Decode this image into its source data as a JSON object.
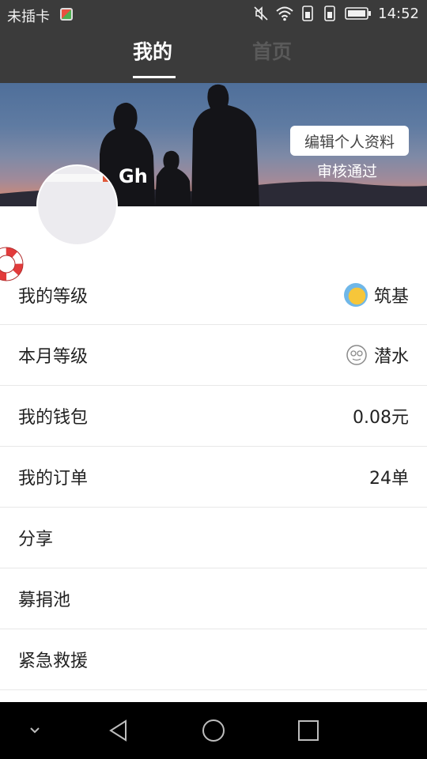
{
  "status_bar": {
    "carrier": "未插卡",
    "time": "14:52"
  },
  "tabs": [
    {
      "label": "我的",
      "active": true
    },
    {
      "label": "首页",
      "active": false
    }
  ],
  "profile": {
    "edit_button": "编辑个人资料",
    "review_status": "审核通过",
    "username": "Gh"
  },
  "menu": [
    {
      "label": "我的等级",
      "value": "筑基",
      "icon": "level-badge-icon"
    },
    {
      "label": "本月等级",
      "value": "潜水",
      "icon": "diver-badge-icon"
    },
    {
      "label": "我的钱包",
      "value": "0.08元"
    },
    {
      "label": "我的订单",
      "value": "24单"
    },
    {
      "label": "分享",
      "value": ""
    },
    {
      "label": "募捐池",
      "value": ""
    },
    {
      "label": "紧急救援",
      "value": ""
    }
  ],
  "colors": {
    "header_bg": "#3b3b3b",
    "tab_inactive": "#5a5a5a",
    "navbar_bg": "#000000"
  }
}
